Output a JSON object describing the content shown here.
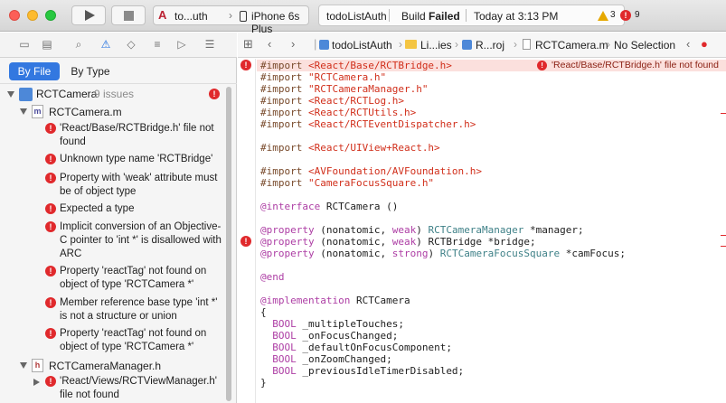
{
  "toolbar": {
    "scheme_project": "to...uth",
    "scheme_separator": "›",
    "scheme_device": "iPhone 6s Plus",
    "activity_project": "todoListAuth",
    "activity_status_prefix": "Build",
    "activity_status": "Failed",
    "activity_time": "Today at 3:13 PM",
    "warning_count": "3",
    "error_count": "9"
  },
  "navigator": {
    "filter_by_file": "By File",
    "filter_by_type": "By Type",
    "group_title": "RCTCamera",
    "group_count": "9 issues",
    "file1_name": "RCTCamera.m",
    "file1_issues": [
      "'React/Base/RCTBridge.h' file not found",
      "Unknown type name 'RCTBridge'",
      "Property with 'weak' attribute must be of object type",
      "Expected a type",
      "Implicit conversion of an Objective-C pointer to 'int *' is disallowed with ARC",
      "Property 'reactTag' not found on object of type 'RCTCamera *'",
      "Member reference base type 'int *' is not a structure or union",
      "Property 'reactTag' not found on object of type 'RCTCamera *'"
    ],
    "file2_name": "RCTCameraManager.h",
    "file2_issue": "'React/Views/RCTViewManager.h' file not found"
  },
  "jumpbar": {
    "crumb_project": "todoListAuth",
    "crumb_folder": "Li...ies",
    "crumb_subproject": "R...roj",
    "crumb_file": "RCTCamera.m",
    "crumb_symbol": "No Selection"
  },
  "editor": {
    "inline_error": "'React/Base/RCTBridge.h' file not found",
    "lines": {
      "l1_kw": "#import",
      "l1_arg": "<React/Base/RCTBridge.h>",
      "l2_kw": "#import",
      "l2_arg": "\"RCTCamera.h\"",
      "l3_kw": "#import",
      "l3_arg": "\"RCTCameraManager.h\"",
      "l4_kw": "#import",
      "l4_arg": "<React/RCTLog.h>",
      "l5_kw": "#import",
      "l5_arg": "<React/RCTUtils.h>",
      "l6_kw": "#import",
      "l6_arg": "<React/RCTEventDispatcher.h>",
      "l7_kw": "#import",
      "l7_arg": "<React/UIView+React.h>",
      "l8_kw": "#import",
      "l8_arg": "<AVFoundation/AVFoundation.h>",
      "l9_kw": "#import",
      "l9_arg": "\"CameraFocusSquare.h\"",
      "l10_kw": "@interface",
      "l10_rest": " RCTCamera ()",
      "l11_kw": "@property",
      "l11_attr": " (nonatomic, ",
      "l11_weak": "weak",
      "l11_close": ") ",
      "l11_type": "RCTCameraManager",
      "l11_rest": " *manager;",
      "l12_kw": "@property",
      "l12_attr": " (nonatomic, ",
      "l12_weak": "weak",
      "l12_close": ") ",
      "l12_type": "RCTBridge",
      "l12_rest": " *bridge;",
      "l13_kw": "@property",
      "l13_attr": " (nonatomic, ",
      "l13_strong": "strong",
      "l13_close": ") ",
      "l13_type": "RCTCameraFocusSquare",
      "l13_rest": " *camFocus;",
      "l14_kw": "@end",
      "l15_kw": "@implementation",
      "l15_rest": " RCTCamera",
      "l16": "{",
      "l17_kw": "BOOL",
      "l17_rest": " _multipleTouches;",
      "l18_kw": "BOOL",
      "l18_rest": " _onFocusChanged;",
      "l19_kw": "BOOL",
      "l19_rest": " _defaultOnFocusComponent;",
      "l20_kw": "BOOL",
      "l20_rest": " _onZoomChanged;",
      "l21_kw": "BOOL",
      "l21_rest": " _previousIdleTimerDisabled;",
      "l22": "}"
    }
  },
  "colors": {
    "error_red": "#e0292c",
    "warning_yellow": "#e6a800",
    "selection_blue": "#3378e0",
    "keyword_purple": "#ad3da4",
    "string_red": "#d12f1b",
    "type_teal": "#3e8087"
  }
}
